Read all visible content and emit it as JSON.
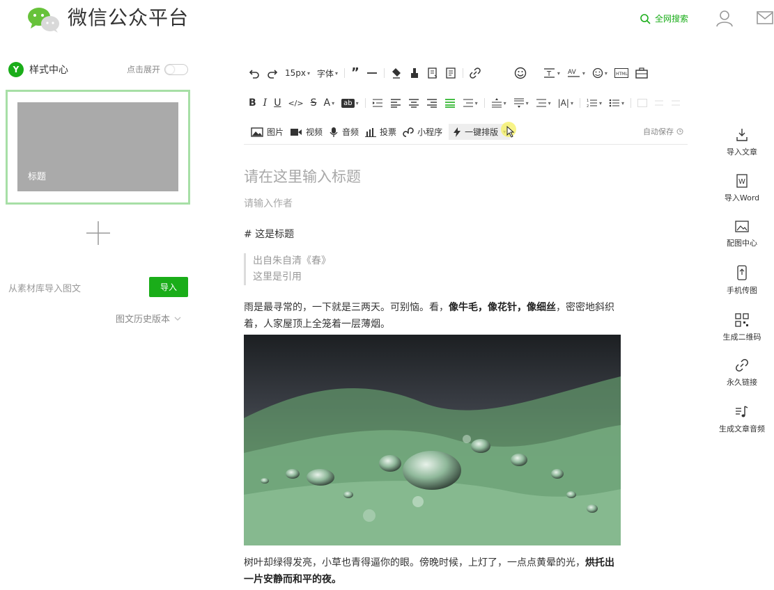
{
  "header": {
    "brand": "微信公众平台",
    "search_label": "全网搜索"
  },
  "left": {
    "style_center": "样式中心",
    "style_badge": "Y",
    "expand_label": "点击展开",
    "article_thumb_title": "标题",
    "import_label": "从素材库导入图文",
    "import_button": "导入",
    "history_label": "图文历史版本"
  },
  "toolbar": {
    "font_size": "15px",
    "font_family": "字体"
  },
  "insert_bar": {
    "image": "图片",
    "video": "视频",
    "audio": "音频",
    "vote": "投票",
    "miniprogram": "小程序",
    "one_click_format": "一键排版",
    "autosave": "自动保存"
  },
  "editor": {
    "title_placeholder": "请在这里输入标题",
    "author_placeholder": "请输入作者",
    "heading_line": "# 这是标题",
    "quote_line1": "出自朱自清《春》",
    "quote_line2": "这里是引用",
    "para1_a": "雨是最寻常的，一下就是三两天。可别恼。看，",
    "para1_bold": "像牛毛，像花针，像细丝",
    "para1_b": "，密密地斜织着，人家屋顶上全笼着一层薄烟。",
    "para2_a": "树叶却绿得发亮，小草也青得逼你的眼。傍晚时候，上灯了，一点点黄晕的光，",
    "para2_bold": "烘托出一片安静而和平的夜。"
  },
  "sidebar": {
    "items": [
      {
        "label": "导入文章",
        "icon": "import-article-icon"
      },
      {
        "label": "导入Word",
        "icon": "word-icon"
      },
      {
        "label": "配图中心",
        "icon": "image-center-icon"
      },
      {
        "label": "手机传图",
        "icon": "phone-upload-icon"
      },
      {
        "label": "生成二维码",
        "icon": "qrcode-icon"
      },
      {
        "label": "永久链接",
        "icon": "link-icon"
      },
      {
        "label": "生成文章音频",
        "icon": "audio-note-icon"
      }
    ]
  },
  "colors": {
    "accent": "#1aad19",
    "card_border": "#a7dfa6",
    "thumb_bg": "#aaaaaa"
  }
}
